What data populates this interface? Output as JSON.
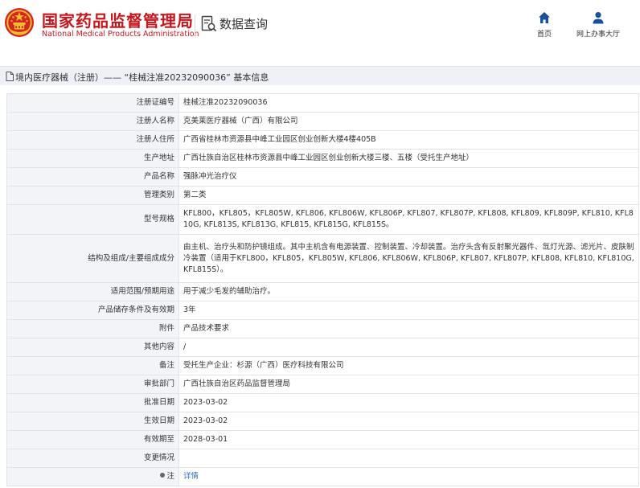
{
  "header": {
    "org_name_cn": "国家药品监督管理局",
    "org_name_en": "National Medical Products Administration",
    "page_title": "数据查询",
    "nav": [
      {
        "label": "首页",
        "icon": "home-icon"
      },
      {
        "label": "网上办事大厅",
        "icon": "user-icon"
      }
    ]
  },
  "breadcrumb": {
    "text": "境内医疗器械（注册）——  “桂械注准20232090036” 基本信息"
  },
  "details": [
    {
      "label": "注册证编号",
      "value": "桂械注准20232090036"
    },
    {
      "label": "注册人名称",
      "value": "克美莱医疗器械（广西）有限公司"
    },
    {
      "label": "注册人住所",
      "value": "广西省桂林市资源县中峰工业园区创业创新大楼4楼405B"
    },
    {
      "label": "生产地址",
      "value": "广西壮族自治区桂林市资源县中峰工业园区创业创新大楼三楼、五楼（受托生产地址）"
    },
    {
      "label": "产品名称",
      "value": "强脉冲光治疗仪"
    },
    {
      "label": "管理类别",
      "value": "第二类"
    },
    {
      "label": "型号规格",
      "value": "KFL800，KFL805，KFL805W, KFL806, KFL806W, KFL806P, KFL807, KFL807P, KFL808, KFL809, KFL809P, KFL810, KFL810G, KFL813S, KFL813G, KFL815, KFL815G, KFL815S。"
    },
    {
      "label": "结构及组成/主要组成成分",
      "value": "由主机、治疗头和防护镜组成。其中主机含有电源装置、控制装置、冷却装置。治疗头含有反射聚光器件、氙灯光源、滤光片、皮肤制冷装置（适用于KFL800，KFL805，KFL805W, KFL806, KFL806W, KFL806P, KFL807, KFL807P, KFL808, KFL810, KFL810G, KFL815S）。"
    },
    {
      "label": "适用范围/预期用途",
      "value": "用于减少毛发的辅助治疗。"
    },
    {
      "label": "产品储存条件及有效期",
      "value": "3年"
    },
    {
      "label": "附件",
      "value": "产品技术要求"
    },
    {
      "label": "其他内容",
      "value": "/"
    },
    {
      "label": "备注",
      "value": "受托生产企业：杉源（广西）医疗科技有限公司"
    },
    {
      "label": "审批部门",
      "value": "广西壮族自治区药品监督管理局"
    },
    {
      "label": "批准日期",
      "value": "2023-03-02"
    },
    {
      "label": "生效日期",
      "value": "2023-03-02"
    },
    {
      "label": "有效期至",
      "value": "2028-03-01"
    },
    {
      "label": "变更情况",
      "value": ""
    },
    {
      "label": "注",
      "value": "详情"
    }
  ],
  "colors": {
    "brand_red": "#c8161d",
    "nav_blue": "#1a4f9c",
    "link_blue": "#2b6cc4",
    "label_bg": "#f2f4f8",
    "crumb_bg": "#eef0f6"
  }
}
